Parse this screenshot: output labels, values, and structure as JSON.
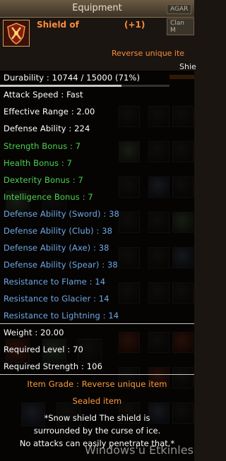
{
  "window": {
    "title": "Equipment",
    "tab1": "AGAR",
    "tab2": "Clan M"
  },
  "item": {
    "icon": "shield-icon",
    "name": "Shield of",
    "suffix": "(+1)",
    "grade_header": "Reverse unique ite",
    "side_label": "Shie",
    "durability": "Durability : 10744 / 15000 (71%)",
    "durability_fraction": 0.716
  },
  "stats": [
    {
      "text": "Attack Speed : Fast",
      "color": "white"
    },
    {
      "text": "Effective Range : 2.00",
      "color": "white"
    },
    {
      "text": "Defense Ability : 224",
      "color": "white"
    },
    {
      "text": "Strength Bonus : 7",
      "color": "green"
    },
    {
      "text": "Health Bonus : 7",
      "color": "green"
    },
    {
      "text": "Dexterity Bonus : 7",
      "color": "green"
    },
    {
      "text": "Intelligence Bonus : 7",
      "color": "green"
    },
    {
      "text": "Defense Ability (Sword) : 38",
      "color": "blue"
    },
    {
      "text": "Defense Ability (Club) : 38",
      "color": "blue"
    },
    {
      "text": "Defense Ability (Axe) : 38",
      "color": "blue"
    },
    {
      "text": "Defense Ability (Spear) : 38",
      "color": "blue"
    },
    {
      "text": "Resistance to Flame : 14",
      "color": "blue"
    },
    {
      "text": "Resistance to Glacier : 14",
      "color": "blue"
    },
    {
      "text": "Resistance to Lightning : 14",
      "color": "blue"
    }
  ],
  "requirements": [
    "Weight : 20.00",
    "Required Level : 70",
    "Required Strength : 106"
  ],
  "grade": "Item Grade : Reverse unique item",
  "sealed": "Sealed item",
  "description": [
    "*Snow shield The shield is",
    "surrounded by the curse of ice.",
    "No attacks can easily penetrate that.*"
  ],
  "watermark": "Windows'u Etkinles",
  "colors": {
    "white": "#ffffff",
    "green": "#4ed14e",
    "blue": "#6fa8e6",
    "orange": "#ff9a3a"
  }
}
